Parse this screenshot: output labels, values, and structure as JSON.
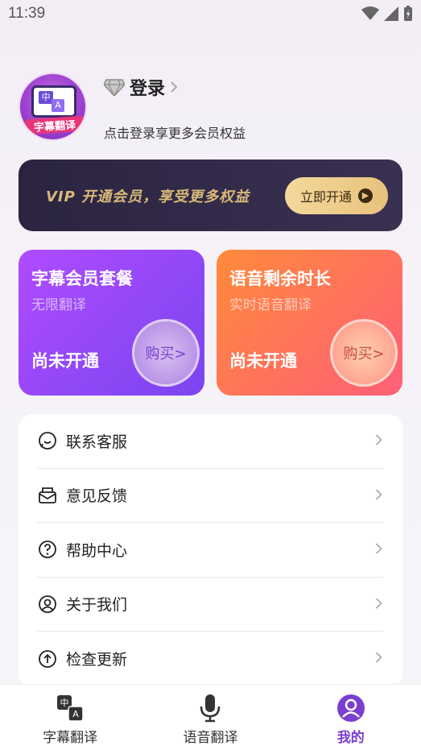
{
  "status_bar": {
    "time": "11:39"
  },
  "profile": {
    "avatar_caption": "字幕翻译",
    "avatar_zh": "中",
    "avatar_a": "A",
    "login_label": "登录",
    "login_subtitle": "点击登录享更多会员权益"
  },
  "vip_banner": {
    "text": "VIP 开通会员，享受更多权益",
    "button_label": "立即开通"
  },
  "cards": [
    {
      "title": "字幕会员套餐",
      "subtitle": "无限翻译",
      "status": "尚未开通",
      "buy_label": "购买>"
    },
    {
      "title": "语音剩余时长",
      "subtitle": "实时语音翻译",
      "status": "尚未开通",
      "buy_label": "购买>"
    }
  ],
  "menu": {
    "items": [
      {
        "label": "联系客服",
        "icon": "chat-icon"
      },
      {
        "label": "意见反馈",
        "icon": "feedback-icon"
      },
      {
        "label": "帮助中心",
        "icon": "help-icon"
      },
      {
        "label": "关于我们",
        "icon": "user-circle-icon"
      },
      {
        "label": "检查更新",
        "icon": "update-icon"
      }
    ]
  },
  "tabbar": {
    "tabs": [
      {
        "label": "字幕翻译",
        "icon": "translate-icon",
        "active": false
      },
      {
        "label": "语音翻译",
        "icon": "microphone-icon",
        "active": false
      },
      {
        "label": "我的",
        "icon": "profile-icon",
        "active": true
      }
    ]
  },
  "colors": {
    "accent": "#7a3fd0",
    "vip_gold": "#d8b978",
    "card_purple": "#9a48f6",
    "card_orange": "#ff7a52"
  }
}
